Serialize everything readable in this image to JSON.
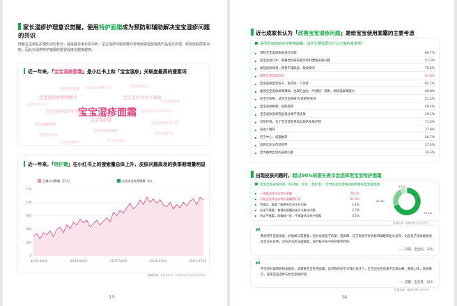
{
  "left_page": {
    "heading": {
      "pre": "家长湿疹护理意识觉醒，使用",
      "highlight": "特护面霜",
      "post": "成为预防和辅助解决宝宝湿疹问题的共识"
    },
    "paragraph": "随着宝宝皮肤护理知识的普及，越来越多家长意识到：宝宝湿疹问题需要日常使用保湿型霜类产品进行护理，修复皮肤屏障功能，因此对湿疹特护面霜的重视程度也越来越高。",
    "cloud_card": {
      "title_pre": "近一年来，「",
      "title_hl": "宝宝湿疹面霜",
      "title_post": "」是小红书上和「宝宝湿疹」关联度最高的搜索词",
      "words": [
        {
          "text": "宝宝湿疹面霜",
          "big": true
        },
        {
          "text": "宝宝湿疹护理用哪个",
          "big": false
        },
        {
          "text": "宝宝湿疹涂什么面霜",
          "big": false
        },
        {
          "text": "宝宝湿疹霜",
          "big": false
        },
        {
          "text": "宝宝湿疹如何护理",
          "big": false
        },
        {
          "text": "宝宝湿疹涂什么护肤品",
          "big": false
        },
        {
          "text": "宝宝面霜推荐",
          "big": false
        },
        {
          "text": "宝宝湿疹用什么好",
          "big": false
        },
        {
          "text": "湿疹宝宝面霜",
          "big": false
        },
        {
          "text": "宝宝湿疹擦什么",
          "big": false
        },
        {
          "text": "宝宝湿疹怎么办",
          "big": false
        },
        {
          "text": "湿疹面霜宝宝",
          "big": false
        },
        {
          "text": "宝宝湿疹面霜推荐",
          "big": false
        },
        {
          "text": "宝宝湿疹修复",
          "big": false
        },
        {
          "text": "宝宝湿疹护理",
          "big": false
        },
        {
          "text": "宝宝湿疹面霜哪个好",
          "big": false
        },
        {
          "text": "婴儿湿疹面霜",
          "big": false
        },
        {
          "text": "宝宝湿疹霜推荐",
          "big": false
        }
      ]
    },
    "chart_card": {
      "title_pre": "近一年来，「",
      "title_hl": "特护霜",
      "title_post": "」在小红书上的搜索量总体上升，皮肤问题高发的换季期增量明显",
      "source": "数据来源：小红书平台，2023/05/29-2024/05/19"
    },
    "chart_data": {
      "type": "line",
      "series": [
        {
          "name": "日搜人口数量（万人）",
          "color": "#f08aaa"
        },
        {
          "name": "点击宝宝交易搜量（亿）",
          "color": "#1aab4b"
        }
      ],
      "x_ticks": [
        "05/29-06/04",
        "08/28-09/03",
        "11/27-12/03",
        "02/26-03/03",
        "05/13-05/19"
      ],
      "y_ticks": [
        "0",
        "300",
        "600",
        "900",
        "1.2K",
        "1.5K"
      ],
      "ylim": [
        0,
        1500
      ],
      "values": [
        450,
        500,
        380,
        520,
        470,
        560,
        430,
        600,
        640,
        520,
        700,
        610,
        760,
        690,
        820,
        740,
        800,
        650,
        720,
        800,
        690,
        780,
        860,
        760,
        980,
        900,
        1020,
        960,
        1080,
        1180,
        1050,
        1120,
        1250,
        1150,
        1320,
        1200,
        1280,
        1180,
        1260,
        1140,
        1100,
        1200,
        1050,
        1150,
        1080,
        1200,
        1120,
        1230,
        1280,
        1150,
        1310,
        1250
      ]
    },
    "page_number": "13"
  },
  "right_page": {
    "heading": {
      "pre": "近七成家长认为「",
      "highlight": "改善宝宝湿疹问题",
      "post": "」是给宝宝使用面霜的主要考虑"
    },
    "question": "请问您目前给宝宝使用面霜，请问主要是因为什么方面的考虑呢?",
    "bars": [
      {
        "label": "预防宝宝面部皮肤发红问题",
        "value": "69.7%",
        "hl": false
      },
      {
        "label": "宝宝出现口水，刺痛湿疹越来越常等刺激性皮肤问题",
        "value": "57.3%",
        "hl": false
      },
      {
        "label": "加强皮肤保湿，改善干燥脱皮、脱皮情况",
        "value": "75.6%",
        "hl": false
      },
      {
        "label": "改善宝宝湿疹症状",
        "value": "67.6%",
        "hl": true
      },
      {
        "label": "宝宝皮肤出现发干、发热疹、口水疹",
        "value": "62.7%",
        "hl": false
      },
      {
        "label": "虚弱宝宝皮肤屏障薄弱，出现红血丝（手臭脸）现象，想加强屏障能力",
        "value": "60.8%",
        "hl": false
      },
      {
        "label": "给宝宝防晒，适宜宝宝肤质乃/日晒性状况",
        "value": "51.5%",
        "hl": false
      },
      {
        "label": "宝宝皮肤敏感，皮肤变厚",
        "value": "46.4%",
        "hl": false
      },
      {
        "label": "宝宝皮肤因病而出现过痛不哭皮肤",
        "value": "39.1%",
        "hl": false
      },
      {
        "label": "日常护理，为了宝宝得到更高品质的皮肤护理",
        "value": "71.6%",
        "hl": false
      },
      {
        "label": "身边人推荐",
        "value": "37.8%",
        "hl": false
      },
      {
        "label": "月子中心、闺蜜推荐",
        "value": "26.7%",
        "hl": false
      },
      {
        "label": "品牌信任与市场宣传",
        "value": "27.4%",
        "hl": false
      },
      {
        "label": "因为换季出现的皮肤问题",
        "value": "20.3%",
        "hl": false
      }
    ],
    "section2": {
      "heading_pre": "出现皮肤问题时，",
      "heading_hl": "超过90%的家长表示会选择用宝宝特护面霜",
      "question": "宝宝出现皮肤问题（如过敏、红疹、湿疹等），您觉得是否需要选择用特护型宝宝面霜",
      "options": [
        {
          "label": "一定要选择宝宝特护面霜",
          "value": "70.2%",
          "color": "#1aab4b"
        },
        {
          "label": "可能会选择宝宝特护面霜更好点",
          "value": "21.9%",
          "color": "#7fcf99"
        },
        {
          "label": "不确定，需要了解更多信息才好判断",
          "value": "5.1%",
          "color": "#bde5c8"
        },
        {
          "label": "应该不需要，普通的面霜应该可以解决问题",
          "value": "2.7%",
          "color": "#dcdcdc"
        },
        {
          "label": "肯定不需要，面霜都一样，不需要选用特护面霜",
          "value": "0.1%",
          "color": "#f0f0f0"
        }
      ],
      "source": "数据来源：母婴护理行业白皮书",
      "pie_labels": {
        "main": "70.2%",
        "second": "21.9%",
        "third": "5.1%"
      }
    },
    "quotes": [
      {
        "text": "我觉得不是能发现，护肤解决是重要，因为发现孩子的第一道屏障，孩子皮肤不好会影响睡眠和生长发育，比起孩子皮肤能搞清是否正在好转，没有办法区分面霜类，这时候于孩子的效果不利好。",
        "author": "——济南，宝宝妈，32岁"
      },
      {
        "text": "怀孕的时候看到很多推荐，说需要宝宝专用面霜，这时我开始学习我们关注了，宝宝出生后有孩子又很文静，我很心疼，就去看见，后来还是选择在给宝宝做护理。",
        "author": "——成都，宝宝爸，32岁"
      }
    ],
    "quote_source": "数据来源：母婴护理行业白皮书",
    "page_number": "14"
  }
}
